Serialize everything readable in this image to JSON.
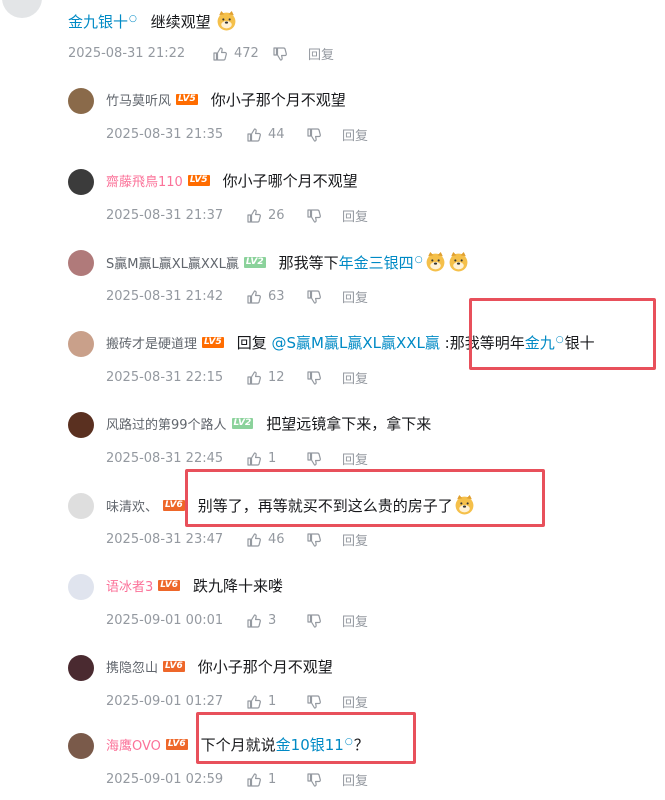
{
  "main_comment": {
    "link_text": "金九银十",
    "text": "继续观望",
    "time": "2025-08-31 21:22",
    "likes": "472",
    "reply_label": "回复"
  },
  "replies": [
    {
      "user": "竹马莫听风",
      "level": "LV5",
      "level_color": "#ff6c00",
      "name_color": "#61666d",
      "text": "你小子那个月不观望",
      "time": "2025-08-31 21:35",
      "likes": "44",
      "reply_label": "回复",
      "avatar_color": "#8a6a4a"
    },
    {
      "user": "齋藤飛鳥110",
      "level": "LV5",
      "level_color": "#ff6c00",
      "name_color": "#fb7299",
      "text": "你小子哪个月不观望",
      "time": "2025-08-31 21:37",
      "likes": "26",
      "reply_label": "回复",
      "avatar_color": "#3b3b3b"
    },
    {
      "user": "S贏M贏L贏XL贏XXL贏",
      "level": "LV2",
      "level_color": "#8bd29b",
      "name_color": "#61666d",
      "text_pre": "那我等下",
      "link_text": "年金三银四",
      "time": "2025-08-31 21:42",
      "likes": "63",
      "reply_label": "回复",
      "avatar_color": "#b07a7a"
    },
    {
      "user": "搬砖才是硬道理",
      "level": "LV5",
      "level_color": "#ff6c00",
      "name_color": "#61666d",
      "reply_prefix": "回复 ",
      "mention": "@S贏M贏L贏XL贏XXL贏",
      "text_mid": " :那我等明年",
      "link_text": "金九",
      "text_post": "银十",
      "time": "2025-08-31 22:15",
      "likes": "12",
      "reply_label": "回复",
      "avatar_color": "#c9a08a"
    },
    {
      "user": "风路过的第99个路人",
      "level": "LV2",
      "level_color": "#8bd29b",
      "name_color": "#61666d",
      "text": "把望远镜拿下来，拿下来",
      "time": "2025-08-31 22:45",
      "likes": "1",
      "reply_label": "回复",
      "avatar_color": "#5a3020"
    },
    {
      "user": "味清欢、",
      "level": "LV6",
      "level_color": "#ee672a",
      "name_color": "#61666d",
      "text": "别等了，再等就买不到这么贵的房子了",
      "time": "2025-08-31 23:47",
      "likes": "46",
      "reply_label": "回复",
      "avatar_color": "#dedede"
    },
    {
      "user": "语冰者3",
      "level": "LV6",
      "level_color": "#ee672a",
      "name_color": "#fb7299",
      "text": "跌九降十来喽",
      "time": "2025-09-01 00:01",
      "likes": "3",
      "reply_label": "回复",
      "avatar_color": "#e0e4ee"
    },
    {
      "user": "携隐忽山",
      "level": "LV6",
      "level_color": "#ee672a",
      "name_color": "#61666d",
      "text": "你小子那个月不观望",
      "time": "2025-09-01 01:27",
      "likes": "1",
      "reply_label": "回复",
      "avatar_color": "#4a2a30"
    },
    {
      "user": "海鹰OVO",
      "level": "LV6",
      "level_color": "#ee672a",
      "name_color": "#fb7299",
      "text_pre": "下个月就说",
      "link_text": "金10银11",
      "text_post": "？",
      "time": "2025-09-01 02:59",
      "likes": "1",
      "reply_label": "回复",
      "avatar_color": "#7a5a4a"
    }
  ],
  "colors": {
    "highlight_box": "#e8505b",
    "link": "#008ac5",
    "meta": "#9499a0"
  }
}
